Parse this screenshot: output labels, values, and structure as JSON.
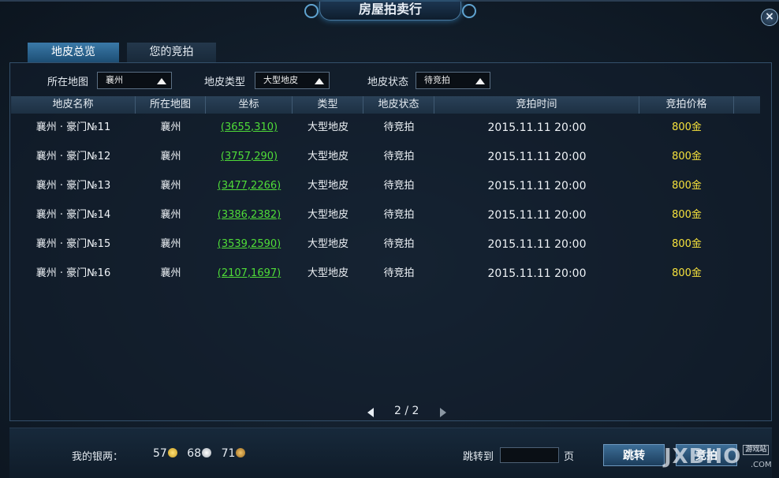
{
  "window": {
    "title": "房屋拍卖行",
    "close_icon": "×"
  },
  "tabs": [
    {
      "label": "地皮总览",
      "active": true
    },
    {
      "label": "您的竞拍",
      "active": false
    }
  ],
  "filters": {
    "map_label": "所在地图",
    "map_value": "襄州",
    "type_label": "地皮类型",
    "type_value": "大型地皮",
    "status_label": "地皮状态",
    "status_value": "待竞拍"
  },
  "table": {
    "headers": [
      "地皮名称",
      "所在地图",
      "坐标",
      "类型",
      "地皮状态",
      "竞拍时间",
      "竞拍价格"
    ],
    "rows": [
      {
        "name": "襄州 · 豪门№11",
        "map": "襄州",
        "coord": "(3655,310)",
        "type": "大型地皮",
        "status": "待竞拍",
        "time": "2015.11.11 20:00",
        "price": "800金"
      },
      {
        "name": "襄州 · 豪门№12",
        "map": "襄州",
        "coord": "(3757,290)",
        "type": "大型地皮",
        "status": "待竞拍",
        "time": "2015.11.11 20:00",
        "price": "800金"
      },
      {
        "name": "襄州 · 豪门№13",
        "map": "襄州",
        "coord": "(3477,2266)",
        "type": "大型地皮",
        "status": "待竞拍",
        "time": "2015.11.11 20:00",
        "price": "800金"
      },
      {
        "name": "襄州 · 豪门№14",
        "map": "襄州",
        "coord": "(3386,2382)",
        "type": "大型地皮",
        "status": "待竞拍",
        "time": "2015.11.11 20:00",
        "price": "800金"
      },
      {
        "name": "襄州 · 豪门№15",
        "map": "襄州",
        "coord": "(3539,2590)",
        "type": "大型地皮",
        "status": "待竞拍",
        "time": "2015.11.11 20:00",
        "price": "800金"
      },
      {
        "name": "襄州 · 豪门№16",
        "map": "襄州",
        "coord": "(2107,1697)",
        "type": "大型地皮",
        "status": "待竞拍",
        "time": "2015.11.11 20:00",
        "price": "800金"
      }
    ]
  },
  "pager": {
    "text": "2 / 2"
  },
  "footer": {
    "silver_label": "我的银两：",
    "gold": "57",
    "silver": "68",
    "copper": "71",
    "jump_label": "跳转到",
    "jump_value": "",
    "page_suffix": "页",
    "jump_button": "跳转",
    "bid_button": "竞拍"
  },
  "watermark": {
    "main": "JXBHO",
    "badge": "游戏站",
    "com": ".COM"
  }
}
